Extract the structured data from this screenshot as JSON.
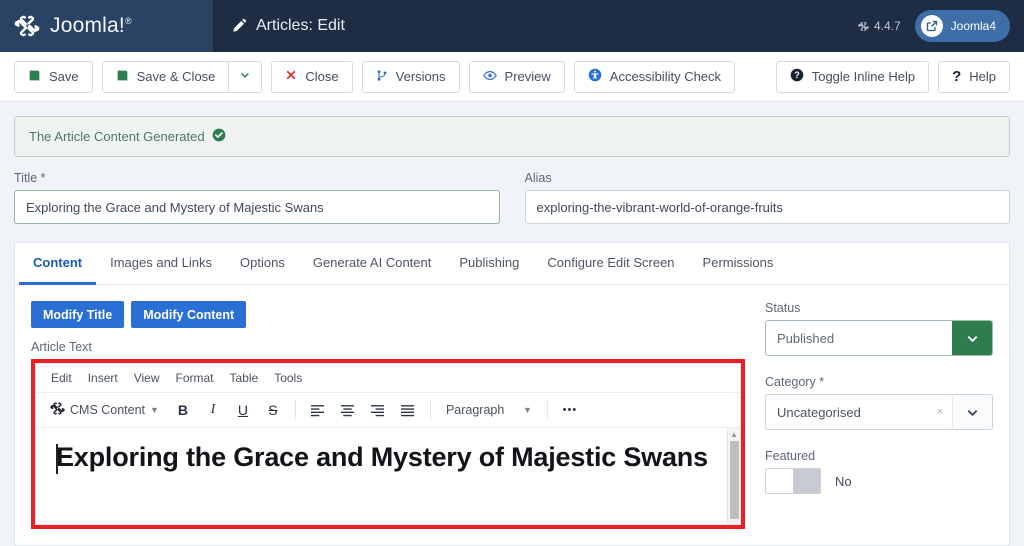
{
  "header": {
    "brand": "Joomla!",
    "brand_sup": "®",
    "page_title": "Articles: Edit",
    "version": "4.4.7",
    "user": "Joomla4"
  },
  "toolbar": {
    "save": "Save",
    "save_close": "Save & Close",
    "close": "Close",
    "versions": "Versions",
    "preview": "Preview",
    "accessibility": "Accessibility Check",
    "toggle_help": "Toggle Inline Help",
    "help": "Help"
  },
  "alert": {
    "message": "The Article Content Generated"
  },
  "fields": {
    "title_label": "Title *",
    "title_value": "Exploring the Grace and Mystery of Majestic Swans",
    "alias_label": "Alias",
    "alias_value": "exploring-the-vibrant-world-of-orange-fruits"
  },
  "tabs": [
    {
      "label": "Content",
      "active": true
    },
    {
      "label": "Images and Links",
      "active": false
    },
    {
      "label": "Options",
      "active": false
    },
    {
      "label": "Generate AI Content",
      "active": false
    },
    {
      "label": "Publishing",
      "active": false
    },
    {
      "label": "Configure Edit Screen",
      "active": false
    },
    {
      "label": "Permissions",
      "active": false
    }
  ],
  "actions": {
    "modify_title": "Modify Title",
    "modify_content": "Modify Content"
  },
  "editor": {
    "article_text_label": "Article Text",
    "menubar": [
      "Edit",
      "Insert",
      "View",
      "Format",
      "Table",
      "Tools"
    ],
    "cms_content": "CMS Content",
    "bold": "B",
    "italic": "I",
    "underline": "U",
    "strike": "S",
    "format_select": "Paragraph",
    "more": "•••",
    "body_heading": "Exploring the Grace and Mystery of Majestic Swans"
  },
  "sidebar": {
    "status_label": "Status",
    "status_value": "Published",
    "category_label": "Category *",
    "category_value": "Uncategorised",
    "category_clear": "×",
    "featured_label": "Featured",
    "featured_value": "No"
  },
  "colors": {
    "header_bg": "#1f2d44",
    "brand_bg": "#2a4365",
    "accent_blue": "#2a6fd4",
    "success_green": "#2e7d4f",
    "danger_red": "#d9342b",
    "highlight_red": "#ec2127"
  }
}
